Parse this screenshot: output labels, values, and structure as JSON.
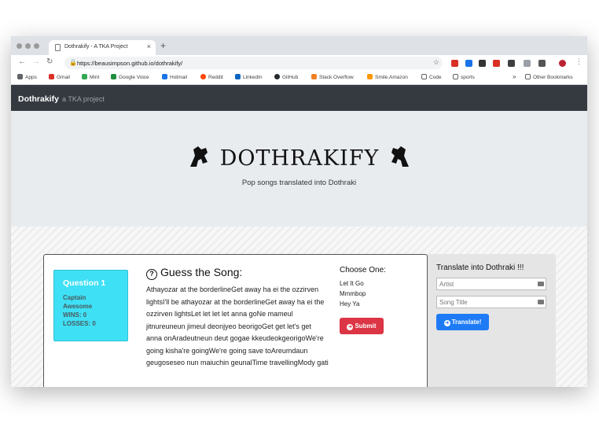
{
  "browser": {
    "tab_title": "Dothrakify - A TKA Project",
    "tab_close": "×",
    "new_tab": "+",
    "url": "https://beausimpson.github.io/dothrakify/",
    "bookmarks": [
      {
        "label": "Apps",
        "color": "#5f6368"
      },
      {
        "label": "Gmail",
        "color": "#d93025"
      },
      {
        "label": "Mint",
        "color": "#34a853"
      },
      {
        "label": "Google Voice",
        "color": "#1e8e3e"
      },
      {
        "label": "Hotmail",
        "color": "#1a73e8"
      },
      {
        "label": "Reddit",
        "color": "#ff4500"
      },
      {
        "label": "LinkedIn",
        "color": "#0a66c2"
      },
      {
        "label": "GitHub",
        "color": "#24292e"
      },
      {
        "label": "Stack Overflow",
        "color": "#f48024"
      },
      {
        "label": "Smile.Amazon",
        "color": "#ff9900"
      },
      {
        "label": "Code",
        "color": "#5f6368"
      },
      {
        "label": "sports",
        "color": "#5f6368"
      }
    ],
    "bookmarks_overflow": "»",
    "other_bookmarks": "Other Bookmarks"
  },
  "site": {
    "brand": "Dothrakify",
    "brand_sub": "a TKA project",
    "logo_text": "DOTHRAKIFY",
    "tagline": "Pop songs translated into Dothraki"
  },
  "game": {
    "question": "Question 1",
    "player_line1": "Captain",
    "player_line2": "Awesome",
    "wins": "WINS: 0",
    "losses": "LOSSES: 0",
    "heading": "Guess the Song:",
    "lyrics": "Athayozar at the borderlineGet away ha ei the ozzirven lightsI'll be athayozar at the borderlineGet away ha ei the ozzirven lightsLet let let let anna goNe mameul jitnureuneun jimeul deonjyeo beorigoGet get let's get anna onAradeutneun deut gogae kkeudeokgeorigoWe're going kisha're goingWe're going save toAreumdaun geugoseseo nun maiuchin geunalTime travellingMody gati",
    "choose_heading": "Choose One:",
    "choices": [
      "Let It Go",
      "Mmmbop",
      "Hey Ya"
    ],
    "submit_label": "Submit"
  },
  "translate": {
    "heading": "Translate into Dothraki !!!",
    "artist_placeholder": "Artist",
    "title_placeholder": "Song Title",
    "button_label": "Translate!"
  }
}
